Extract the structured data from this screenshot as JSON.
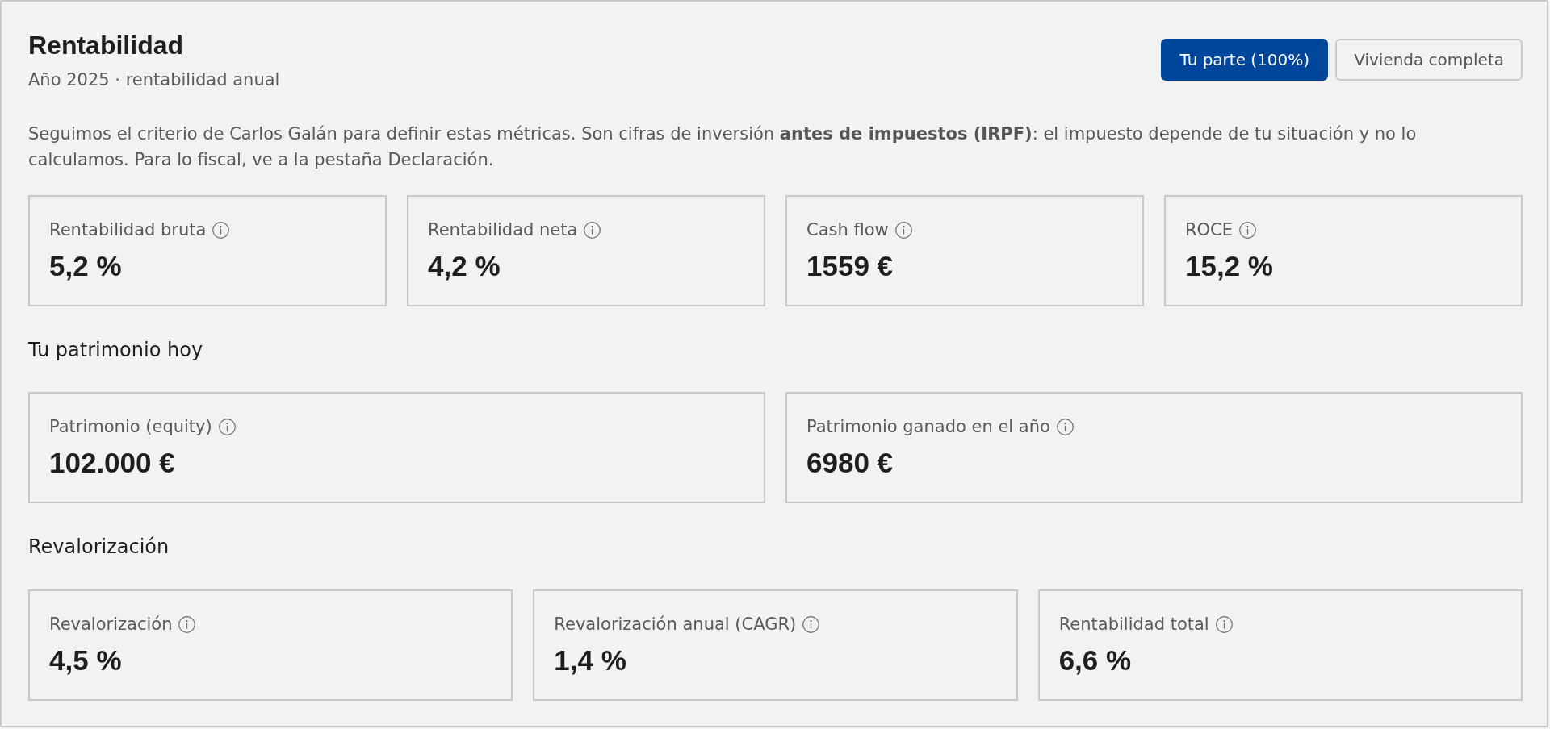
{
  "title": "Rentabilidad",
  "subtitle": "Año 2025 · rentabilidad anual",
  "view_toggle": [
    {
      "label": "Tu parte (100%)",
      "selected": true
    },
    {
      "label": "Vivienda completa",
      "selected": false
    }
  ],
  "note": "Seguimos el criterio de Carlos Galán para definir estas métricas. Son cifras de inversión **antes de impuestos (IRPF)**: el impuesto depende de tu situación y no lo calculamos. Para lo fiscal, ve a la pestaña Declaración.",
  "sections": [
    {
      "metrics": [
        {
          "label": "Rentabilidad bruta",
          "value": "5,2 %"
        },
        {
          "label": "Rentabilidad neta",
          "value": "4,2 %"
        },
        {
          "label": "Cash flow",
          "value": "1559 €"
        },
        {
          "label": "ROCE",
          "value": "15,2 %"
        }
      ]
    },
    {
      "heading": "Tu patrimonio hoy",
      "metrics": [
        {
          "label": "Patrimonio (equity)",
          "value": "102.000 €"
        },
        {
          "label": "Patrimonio ganado en el año",
          "value": "6980 €"
        }
      ]
    },
    {
      "heading": "Revalorización",
      "metrics": [
        {
          "label": "Revalorización",
          "value": "4,5 %"
        },
        {
          "label": "Revalorización anual (CAGR)",
          "value": "1,4 %"
        },
        {
          "label": "Rentabilidad total",
          "value": "6,6 %"
        }
      ]
    }
  ]
}
